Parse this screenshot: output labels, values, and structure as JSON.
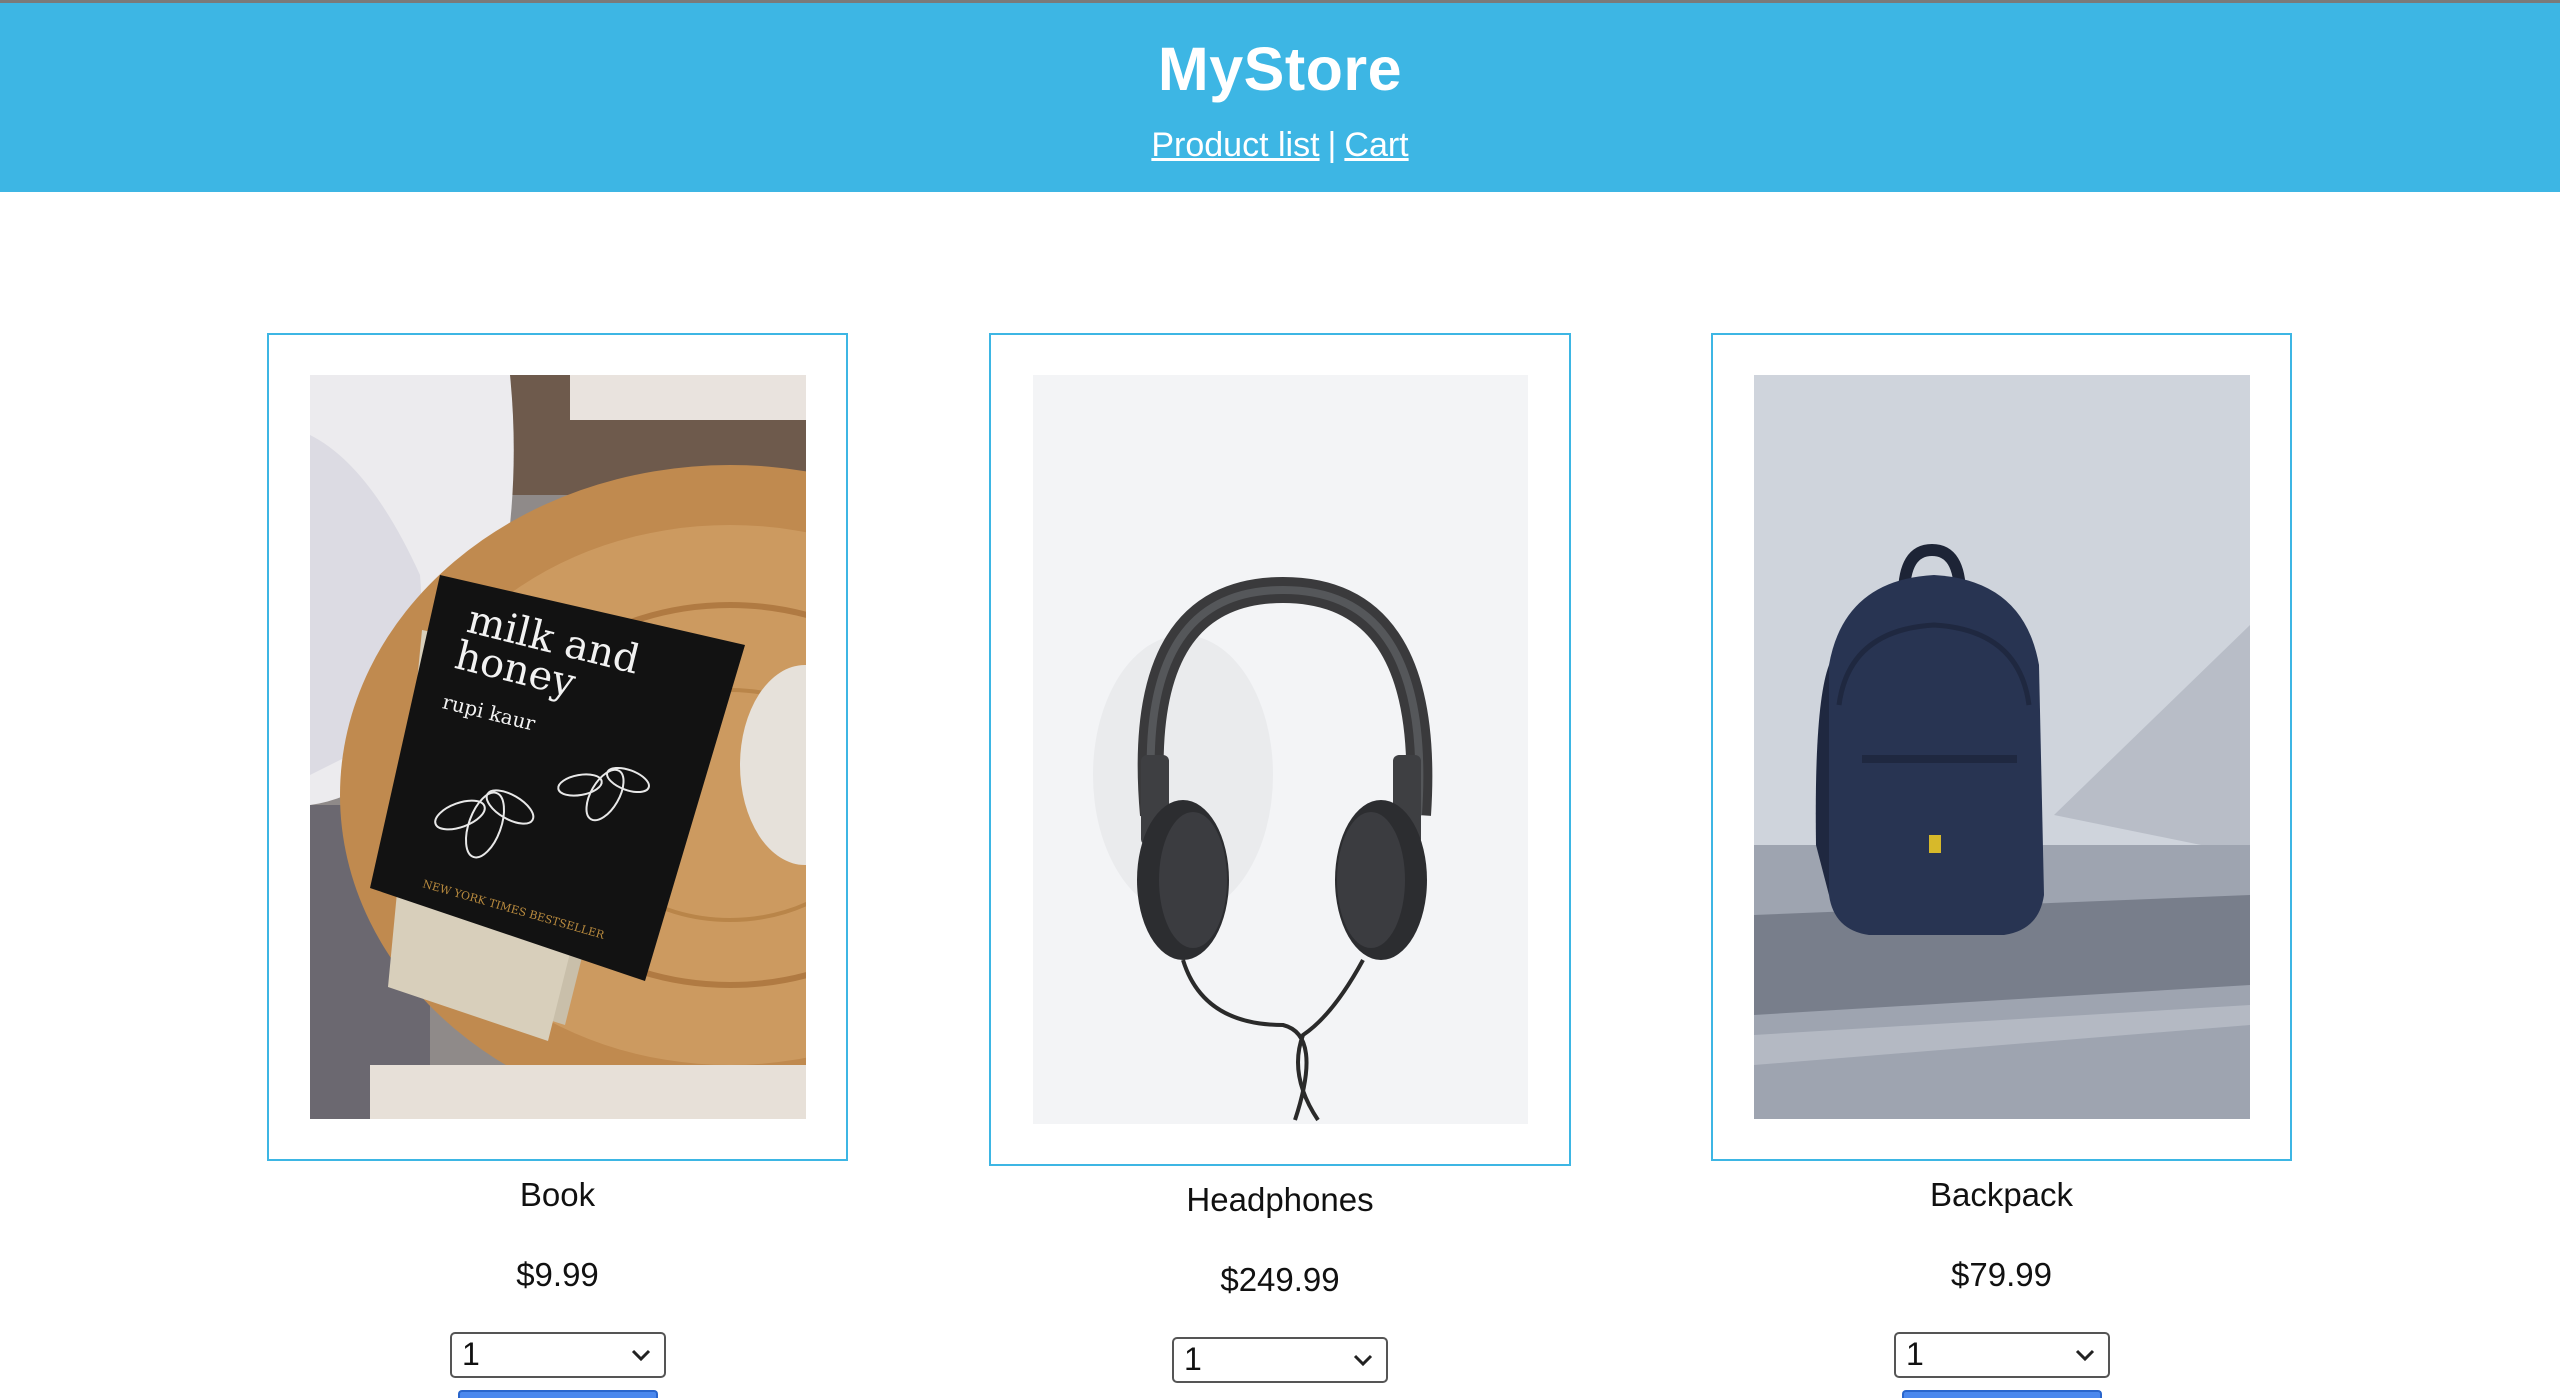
{
  "header": {
    "title": "MyStore",
    "nav": {
      "product_list": "Product list",
      "separator": "|",
      "cart": "Cart"
    }
  },
  "colors": {
    "header_bg": "#3db6e4",
    "card_border": "#3db6e4",
    "button": "#4a88ee"
  },
  "products": [
    {
      "name": "Book",
      "price": "$9.99",
      "quantity": "1",
      "image": "book-photo"
    },
    {
      "name": "Headphones",
      "price": "$249.99",
      "quantity": "1",
      "image": "headphones-photo"
    },
    {
      "name": "Backpack",
      "price": "$79.99",
      "quantity": "1",
      "image": "backpack-photo"
    }
  ],
  "book_cover": {
    "title": "milk and honey",
    "author": "rupi kaur",
    "tagline": "NEW YORK TIMES BESTSELLER"
  }
}
